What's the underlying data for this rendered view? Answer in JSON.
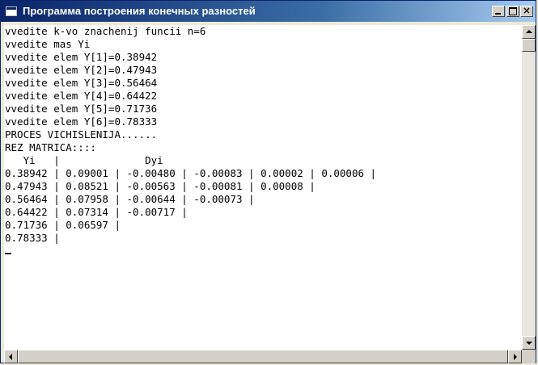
{
  "window": {
    "title": "Программа построения конечных разностей"
  },
  "console": {
    "lines": [
      "vvedite k-vo znachenij funcii n=6",
      "vvedite mas Yi",
      "vvedite elem Y[1]=0.38942",
      "vvedite elem Y[2]=0.47943",
      "vvedite elem Y[3]=0.56464",
      "vvedite elem Y[4]=0.64422",
      "vvedite elem Y[5]=0.71736",
      "vvedite elem Y[6]=0.78333",
      "PROCES VICHISLENIJA......",
      "REZ MATRICA::::",
      "   Yi   |              Dyi",
      "0.38942 | 0.09001 | -0.00480 | -0.00083 | 0.00002 | 0.00006 |",
      "0.47943 | 0.08521 | -0.00563 | -0.00081 | 0.00008 |",
      "0.56464 | 0.07958 | -0.00644 | -0.00073 |",
      "0.64422 | 0.07314 | -0.00717 |",
      "0.71736 | 0.06597 |",
      "0.78333 |"
    ]
  }
}
